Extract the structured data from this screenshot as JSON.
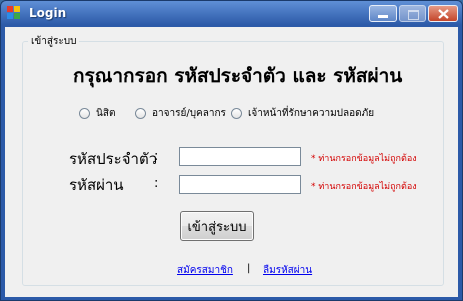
{
  "window": {
    "title": "Login"
  },
  "group": {
    "legend": "เข้าสู่ระบบ"
  },
  "heading": "กรุณากรอก รหัสประจำตัว และ  รหัสผ่าน",
  "roles": [
    {
      "label": "นิสิต"
    },
    {
      "label": "อาจารย์/บุคลากร"
    },
    {
      "label": "เจ้าหน้าที่รักษาความปลอดภัย"
    }
  ],
  "fields": {
    "user_id": {
      "label": "รหัสประจำตัว",
      "colon": ":",
      "value": "",
      "error": "* ท่านกรอกข้อมูลไม่ถูกต้อง"
    },
    "password": {
      "label": "รหัสผ่าน",
      "colon": ":",
      "value": "",
      "error": "* ท่านกรอกข้อมูลไม่ถูกต้อง"
    }
  },
  "submit_label": "เข้าสู่ระบบ",
  "links": {
    "register": "สมัครสมาชิก",
    "separator": "|",
    "forgot": "ลืมรหัสผ่าน"
  },
  "colors": {
    "error": "#d40000",
    "link": "#0000ee",
    "titlebar": "#2c5aa8"
  }
}
